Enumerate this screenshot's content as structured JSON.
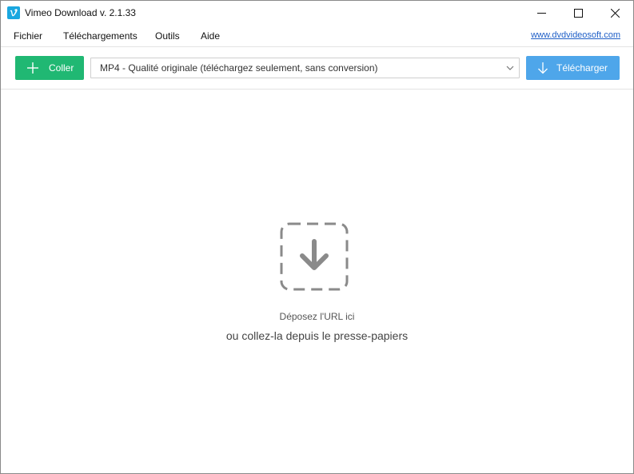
{
  "window": {
    "title": "Vimeo Download v. 2.1.33"
  },
  "menu": {
    "items": [
      "Fichier",
      "Téléchargements",
      "Outils",
      "Aide"
    ],
    "link": "www.dvdvideosoft.com"
  },
  "toolbar": {
    "paste_label": "Coller",
    "format_value": "MP4 - Qualité originale (téléchargez seulement, sans conversion)",
    "download_label": "Télécharger"
  },
  "dropzone": {
    "hint": "Déposez l'URL ici",
    "sub": "ou collez-la depuis le presse-papiers"
  },
  "colors": {
    "paste_button": "#20b873",
    "download_button": "#4ea6ea",
    "app_icon": "#1aa7e0",
    "link": "#1f5fc7",
    "drop_icon": "#8a8a8a"
  },
  "icons": {
    "app": "vimeo-logo-icon",
    "minimize": "minimize-icon",
    "maximize": "maximize-icon",
    "close": "close-icon",
    "paste": "plus-icon",
    "dropdown": "chevron-down-icon",
    "download": "arrow-down-icon",
    "drop": "dashed-download-icon"
  }
}
